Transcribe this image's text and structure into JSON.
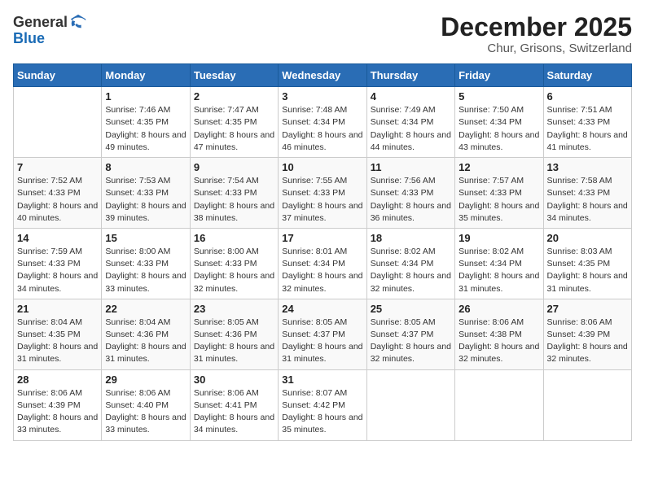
{
  "header": {
    "logo_general": "General",
    "logo_blue": "Blue",
    "month_title": "December 2025",
    "subtitle": "Chur, Grisons, Switzerland"
  },
  "days_of_week": [
    "Sunday",
    "Monday",
    "Tuesday",
    "Wednesday",
    "Thursday",
    "Friday",
    "Saturday"
  ],
  "weeks": [
    [
      {
        "day": "",
        "sunrise": "",
        "sunset": "",
        "daylight": ""
      },
      {
        "day": "1",
        "sunrise": "Sunrise: 7:46 AM",
        "sunset": "Sunset: 4:35 PM",
        "daylight": "Daylight: 8 hours and 49 minutes."
      },
      {
        "day": "2",
        "sunrise": "Sunrise: 7:47 AM",
        "sunset": "Sunset: 4:35 PM",
        "daylight": "Daylight: 8 hours and 47 minutes."
      },
      {
        "day": "3",
        "sunrise": "Sunrise: 7:48 AM",
        "sunset": "Sunset: 4:34 PM",
        "daylight": "Daylight: 8 hours and 46 minutes."
      },
      {
        "day": "4",
        "sunrise": "Sunrise: 7:49 AM",
        "sunset": "Sunset: 4:34 PM",
        "daylight": "Daylight: 8 hours and 44 minutes."
      },
      {
        "day": "5",
        "sunrise": "Sunrise: 7:50 AM",
        "sunset": "Sunset: 4:34 PM",
        "daylight": "Daylight: 8 hours and 43 minutes."
      },
      {
        "day": "6",
        "sunrise": "Sunrise: 7:51 AM",
        "sunset": "Sunset: 4:33 PM",
        "daylight": "Daylight: 8 hours and 41 minutes."
      }
    ],
    [
      {
        "day": "7",
        "sunrise": "Sunrise: 7:52 AM",
        "sunset": "Sunset: 4:33 PM",
        "daylight": "Daylight: 8 hours and 40 minutes."
      },
      {
        "day": "8",
        "sunrise": "Sunrise: 7:53 AM",
        "sunset": "Sunset: 4:33 PM",
        "daylight": "Daylight: 8 hours and 39 minutes."
      },
      {
        "day": "9",
        "sunrise": "Sunrise: 7:54 AM",
        "sunset": "Sunset: 4:33 PM",
        "daylight": "Daylight: 8 hours and 38 minutes."
      },
      {
        "day": "10",
        "sunrise": "Sunrise: 7:55 AM",
        "sunset": "Sunset: 4:33 PM",
        "daylight": "Daylight: 8 hours and 37 minutes."
      },
      {
        "day": "11",
        "sunrise": "Sunrise: 7:56 AM",
        "sunset": "Sunset: 4:33 PM",
        "daylight": "Daylight: 8 hours and 36 minutes."
      },
      {
        "day": "12",
        "sunrise": "Sunrise: 7:57 AM",
        "sunset": "Sunset: 4:33 PM",
        "daylight": "Daylight: 8 hours and 35 minutes."
      },
      {
        "day": "13",
        "sunrise": "Sunrise: 7:58 AM",
        "sunset": "Sunset: 4:33 PM",
        "daylight": "Daylight: 8 hours and 34 minutes."
      }
    ],
    [
      {
        "day": "14",
        "sunrise": "Sunrise: 7:59 AM",
        "sunset": "Sunset: 4:33 PM",
        "daylight": "Daylight: 8 hours and 34 minutes."
      },
      {
        "day": "15",
        "sunrise": "Sunrise: 8:00 AM",
        "sunset": "Sunset: 4:33 PM",
        "daylight": "Daylight: 8 hours and 33 minutes."
      },
      {
        "day": "16",
        "sunrise": "Sunrise: 8:00 AM",
        "sunset": "Sunset: 4:33 PM",
        "daylight": "Daylight: 8 hours and 32 minutes."
      },
      {
        "day": "17",
        "sunrise": "Sunrise: 8:01 AM",
        "sunset": "Sunset: 4:34 PM",
        "daylight": "Daylight: 8 hours and 32 minutes."
      },
      {
        "day": "18",
        "sunrise": "Sunrise: 8:02 AM",
        "sunset": "Sunset: 4:34 PM",
        "daylight": "Daylight: 8 hours and 32 minutes."
      },
      {
        "day": "19",
        "sunrise": "Sunrise: 8:02 AM",
        "sunset": "Sunset: 4:34 PM",
        "daylight": "Daylight: 8 hours and 31 minutes."
      },
      {
        "day": "20",
        "sunrise": "Sunrise: 8:03 AM",
        "sunset": "Sunset: 4:35 PM",
        "daylight": "Daylight: 8 hours and 31 minutes."
      }
    ],
    [
      {
        "day": "21",
        "sunrise": "Sunrise: 8:04 AM",
        "sunset": "Sunset: 4:35 PM",
        "daylight": "Daylight: 8 hours and 31 minutes."
      },
      {
        "day": "22",
        "sunrise": "Sunrise: 8:04 AM",
        "sunset": "Sunset: 4:36 PM",
        "daylight": "Daylight: 8 hours and 31 minutes."
      },
      {
        "day": "23",
        "sunrise": "Sunrise: 8:05 AM",
        "sunset": "Sunset: 4:36 PM",
        "daylight": "Daylight: 8 hours and 31 minutes."
      },
      {
        "day": "24",
        "sunrise": "Sunrise: 8:05 AM",
        "sunset": "Sunset: 4:37 PM",
        "daylight": "Daylight: 8 hours and 31 minutes."
      },
      {
        "day": "25",
        "sunrise": "Sunrise: 8:05 AM",
        "sunset": "Sunset: 4:37 PM",
        "daylight": "Daylight: 8 hours and 32 minutes."
      },
      {
        "day": "26",
        "sunrise": "Sunrise: 8:06 AM",
        "sunset": "Sunset: 4:38 PM",
        "daylight": "Daylight: 8 hours and 32 minutes."
      },
      {
        "day": "27",
        "sunrise": "Sunrise: 8:06 AM",
        "sunset": "Sunset: 4:39 PM",
        "daylight": "Daylight: 8 hours and 32 minutes."
      }
    ],
    [
      {
        "day": "28",
        "sunrise": "Sunrise: 8:06 AM",
        "sunset": "Sunset: 4:39 PM",
        "daylight": "Daylight: 8 hours and 33 minutes."
      },
      {
        "day": "29",
        "sunrise": "Sunrise: 8:06 AM",
        "sunset": "Sunset: 4:40 PM",
        "daylight": "Daylight: 8 hours and 33 minutes."
      },
      {
        "day": "30",
        "sunrise": "Sunrise: 8:06 AM",
        "sunset": "Sunset: 4:41 PM",
        "daylight": "Daylight: 8 hours and 34 minutes."
      },
      {
        "day": "31",
        "sunrise": "Sunrise: 8:07 AM",
        "sunset": "Sunset: 4:42 PM",
        "daylight": "Daylight: 8 hours and 35 minutes."
      },
      {
        "day": "",
        "sunrise": "",
        "sunset": "",
        "daylight": ""
      },
      {
        "day": "",
        "sunrise": "",
        "sunset": "",
        "daylight": ""
      },
      {
        "day": "",
        "sunrise": "",
        "sunset": "",
        "daylight": ""
      }
    ]
  ]
}
